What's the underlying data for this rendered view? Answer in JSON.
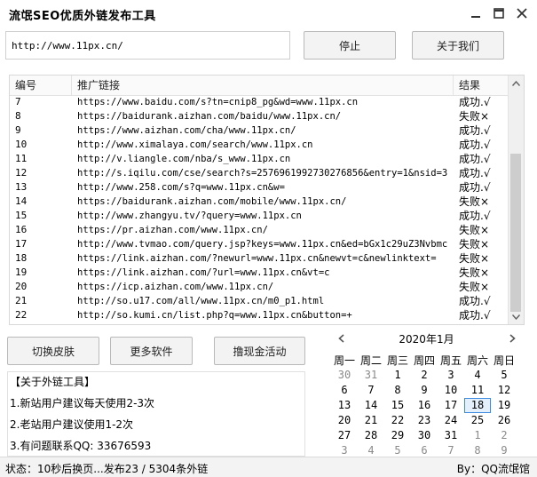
{
  "window": {
    "title": "流氓SEO优质外链发布工具"
  },
  "url_input": {
    "value": "http://www.11px.cn/"
  },
  "buttons": {
    "stop": "停止",
    "about": "关于我们",
    "skin": "切换皮肤",
    "more": "更多软件",
    "cash": "撸现金活动"
  },
  "grid": {
    "headers": {
      "num": "编号",
      "link": "推广链接",
      "result": "结果"
    },
    "rows": [
      {
        "num": "7",
        "url": "https://www.baidu.com/s?tn=cnip8_pg&wd=www.11px.cn",
        "result": "成功.√"
      },
      {
        "num": "8",
        "url": "https://baidurank.aizhan.com/baidu/www.11px.cn/",
        "result": "失败×"
      },
      {
        "num": "9",
        "url": "https://www.aizhan.com/cha/www.11px.cn/",
        "result": "成功.√"
      },
      {
        "num": "10",
        "url": "http://www.ximalaya.com/search/www.11px.cn",
        "result": "成功.√"
      },
      {
        "num": "11",
        "url": "http://v.liangle.com/nba/s_www.11px.cn",
        "result": "成功.√"
      },
      {
        "num": "12",
        "url": "http://s.iqilu.com/cse/search?s=2576961992730276856&entry=1&nsid=3...",
        "result": "成功.√"
      },
      {
        "num": "13",
        "url": "http://www.258.com/s?q=www.11px.cn&w=",
        "result": "成功.√"
      },
      {
        "num": "14",
        "url": "https://baidurank.aizhan.com/mobile/www.11px.cn/",
        "result": "失败×"
      },
      {
        "num": "15",
        "url": "http://www.zhangyu.tv/?query=www.11px.cn",
        "result": "成功.√"
      },
      {
        "num": "16",
        "url": "https://pr.aizhan.com/www.11px.cn/",
        "result": "失败×"
      },
      {
        "num": "17",
        "url": "http://www.tvmao.com/query.jsp?keys=www.11px.cn&ed=bGx1c29uZ3Nvbmc...",
        "result": "失败×"
      },
      {
        "num": "18",
        "url": "https://link.aizhan.com/?newurl=www.11px.cn&newvt=c&newlinktext=",
        "result": "失败×"
      },
      {
        "num": "19",
        "url": "https://link.aizhan.com/?url=www.11px.cn&vt=c",
        "result": "失败×"
      },
      {
        "num": "20",
        "url": "https://icp.aizhan.com/www.11px.cn/",
        "result": "失败×"
      },
      {
        "num": "21",
        "url": "http://so.u17.com/all/www.11px.cn/m0_p1.html",
        "result": "成功.√"
      },
      {
        "num": "22",
        "url": "http://so.kumi.cn/list.php?q=www.11px.cn&button=+",
        "result": "成功.√"
      }
    ]
  },
  "info": {
    "title": "【关于外链工具】",
    "lines": [
      "1.新站用户建议每天使用2-3次",
      "2.老站用户建议使用1-2次",
      "3.有问题联系QQ: 33676593"
    ]
  },
  "calendar": {
    "title": "2020年1月",
    "weekdays": [
      "周一",
      "周二",
      "周三",
      "周四",
      "周五",
      "周六",
      "周日"
    ],
    "weeks": [
      [
        "30",
        "31",
        "1",
        "2",
        "3",
        "4",
        "5"
      ],
      [
        "6",
        "7",
        "8",
        "9",
        "10",
        "11",
        "12"
      ],
      [
        "13",
        "14",
        "15",
        "16",
        "17",
        "18",
        "19"
      ],
      [
        "20",
        "21",
        "22",
        "23",
        "24",
        "25",
        "26"
      ],
      [
        "27",
        "28",
        "29",
        "30",
        "31",
        "1",
        "2"
      ],
      [
        "3",
        "4",
        "5",
        "6",
        "7",
        "8",
        "9"
      ]
    ],
    "today": "18",
    "accent_color": "#3d8be0"
  },
  "status": {
    "left": "状态：10秒后换页...发布23 / 5304条外链",
    "right": "By：QQ流氓馆"
  }
}
